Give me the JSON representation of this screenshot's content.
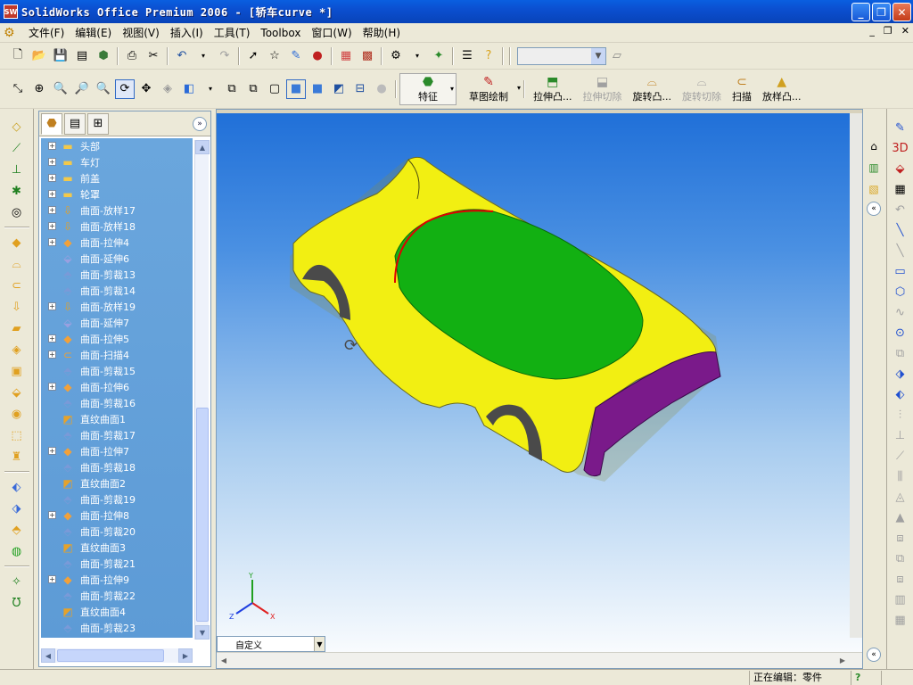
{
  "window": {
    "title": "SolidWorks Office Premium 2006 - [轿车curve *]",
    "app_icon": "SW"
  },
  "window_controls": {
    "minimize": "_",
    "restore": "❐",
    "close": "✕"
  },
  "menu": {
    "items": [
      "文件(F)",
      "编辑(E)",
      "视图(V)",
      "插入(I)",
      "工具(T)",
      "Toolbox",
      "窗口(W)",
      "帮助(H)"
    ],
    "doc_controls": {
      "minimize": "_",
      "restore": "❐",
      "close": "✕"
    }
  },
  "features_toolbar": {
    "feature_label": "特征",
    "sketch_label": "草图绘制",
    "buttons": [
      {
        "label": "拉伸凸...",
        "enabled": true
      },
      {
        "label": "拉伸切除",
        "enabled": false
      },
      {
        "label": "旋转凸...",
        "enabled": true
      },
      {
        "label": "旋转切除",
        "enabled": false
      },
      {
        "label": "扫描",
        "enabled": true
      },
      {
        "label": "放样凸...",
        "enabled": true
      }
    ]
  },
  "feature_tree": {
    "items": [
      {
        "label": "头部",
        "icon": "folder-icon",
        "expandable": true
      },
      {
        "label": "车灯",
        "icon": "folder-icon",
        "expandable": true
      },
      {
        "label": "前盖",
        "icon": "folder-icon",
        "expandable": true
      },
      {
        "label": "轮罩",
        "icon": "folder-icon",
        "expandable": true
      },
      {
        "label": "曲面-放样17",
        "icon": "surface-loft-icon",
        "expandable": true
      },
      {
        "label": "曲面-放样18",
        "icon": "surface-loft-icon",
        "expandable": true
      },
      {
        "label": "曲面-拉伸4",
        "icon": "surface-extrude-icon",
        "expandable": true
      },
      {
        "label": "曲面-延伸6",
        "icon": "surface-extend-icon",
        "expandable": false
      },
      {
        "label": "曲面-剪裁13",
        "icon": "surface-trim-icon",
        "expandable": false
      },
      {
        "label": "曲面-剪裁14",
        "icon": "surface-trim-icon",
        "expandable": false
      },
      {
        "label": "曲面-放样19",
        "icon": "surface-loft-icon",
        "expandable": true
      },
      {
        "label": "曲面-延伸7",
        "icon": "surface-extend-icon",
        "expandable": false
      },
      {
        "label": "曲面-拉伸5",
        "icon": "surface-extrude-icon",
        "expandable": true
      },
      {
        "label": "曲面-扫描4",
        "icon": "surface-sweep-icon",
        "expandable": true
      },
      {
        "label": "曲面-剪裁15",
        "icon": "surface-trim-icon",
        "expandable": false
      },
      {
        "label": "曲面-拉伸6",
        "icon": "surface-extrude-icon",
        "expandable": true
      },
      {
        "label": "曲面-剪裁16",
        "icon": "surface-trim-icon",
        "expandable": false
      },
      {
        "label": "直纹曲面1",
        "icon": "ruled-surface-icon",
        "expandable": false
      },
      {
        "label": "曲面-剪裁17",
        "icon": "surface-trim-icon",
        "expandable": false
      },
      {
        "label": "曲面-拉伸7",
        "icon": "surface-extrude-icon",
        "expandable": true
      },
      {
        "label": "曲面-剪裁18",
        "icon": "surface-trim-icon",
        "expandable": false
      },
      {
        "label": "直纹曲面2",
        "icon": "ruled-surface-icon",
        "expandable": false
      },
      {
        "label": "曲面-剪裁19",
        "icon": "surface-trim-icon",
        "expandable": false
      },
      {
        "label": "曲面-拉伸8",
        "icon": "surface-extrude-icon",
        "expandable": true
      },
      {
        "label": "曲面-剪裁20",
        "icon": "surface-trim-icon",
        "expandable": false
      },
      {
        "label": "直纹曲面3",
        "icon": "ruled-surface-icon",
        "expandable": false
      },
      {
        "label": "曲面-剪裁21",
        "icon": "surface-trim-icon",
        "expandable": false
      },
      {
        "label": "曲面-拉伸9",
        "icon": "surface-extrude-icon",
        "expandable": true
      },
      {
        "label": "曲面-剪裁22",
        "icon": "surface-trim-icon",
        "expandable": false
      },
      {
        "label": "直纹曲面4",
        "icon": "ruled-surface-icon",
        "expandable": false
      },
      {
        "label": "曲面-剪裁23",
        "icon": "surface-trim-icon",
        "expandable": false
      }
    ]
  },
  "viewport": {
    "view_combo_value": "自定义",
    "triad": {
      "x": "X",
      "y": "Y",
      "z": "Z"
    },
    "colors": {
      "body": "#f2ef12",
      "roof": "#12b012",
      "rear": "#7a1a8a",
      "edge": "#e00000"
    }
  },
  "status_bar": {
    "status_text": "正在编辑：零件",
    "help": "?"
  }
}
